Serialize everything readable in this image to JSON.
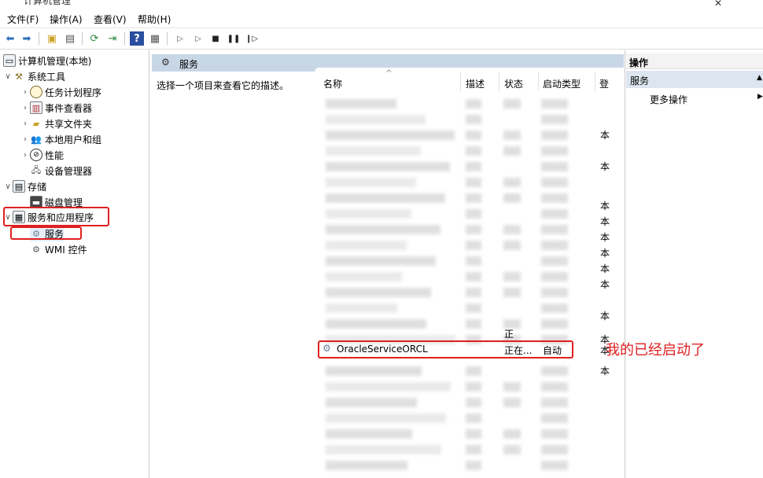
{
  "window": {
    "title": "计算机管理"
  },
  "menu": {
    "file": "文件(F)",
    "action": "操作(A)",
    "view": "查看(V)",
    "help": "帮助(H)"
  },
  "tree": {
    "root": "计算机管理(本地)",
    "system_tools": "系统工具",
    "task_scheduler": "任务计划程序",
    "event_viewer": "事件查看器",
    "shared_folders": "共享文件夹",
    "local_users": "本地用户和组",
    "performance": "性能",
    "device_manager": "设备管理器",
    "storage": "存储",
    "disk_management": "磁盘管理",
    "services_apps": "服务和应用程序",
    "services": "服务",
    "wmi": "WMI 控件"
  },
  "main": {
    "header": "服务",
    "description_hint": "选择一个项目来查看它的描述。",
    "columns": {
      "name": "名称",
      "desc": "描述",
      "status": "状态",
      "startup": "启动类型",
      "logon": "登"
    },
    "row_partial_status": "正",
    "highlight_row": {
      "name": "OracleServiceORCL",
      "status": "正在...",
      "startup": "自动",
      "logon": "本"
    },
    "logon_values": [
      "本",
      "本",
      "本",
      "本",
      "本",
      "本",
      "本",
      "本",
      "本",
      "本",
      "本"
    ]
  },
  "actions": {
    "header": "操作",
    "section": "服务",
    "more": "更多操作"
  },
  "annotation": "我的已经启动了",
  "colors": {
    "highlight_red": "#e02020",
    "pane_header": "#c8d7e6"
  }
}
